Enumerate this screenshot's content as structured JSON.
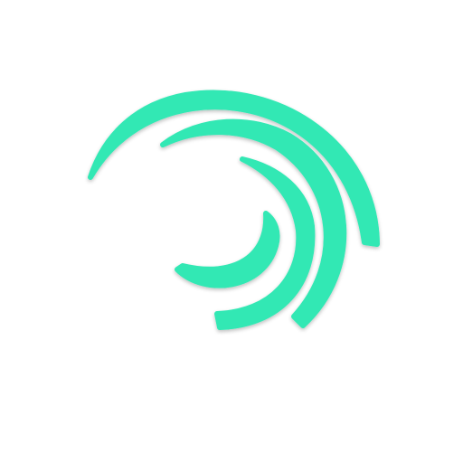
{
  "logo": {
    "icon": "swirl-arcs-icon",
    "color": "#33e8b4",
    "shade": "#24c799",
    "background": "#ffffff"
  }
}
